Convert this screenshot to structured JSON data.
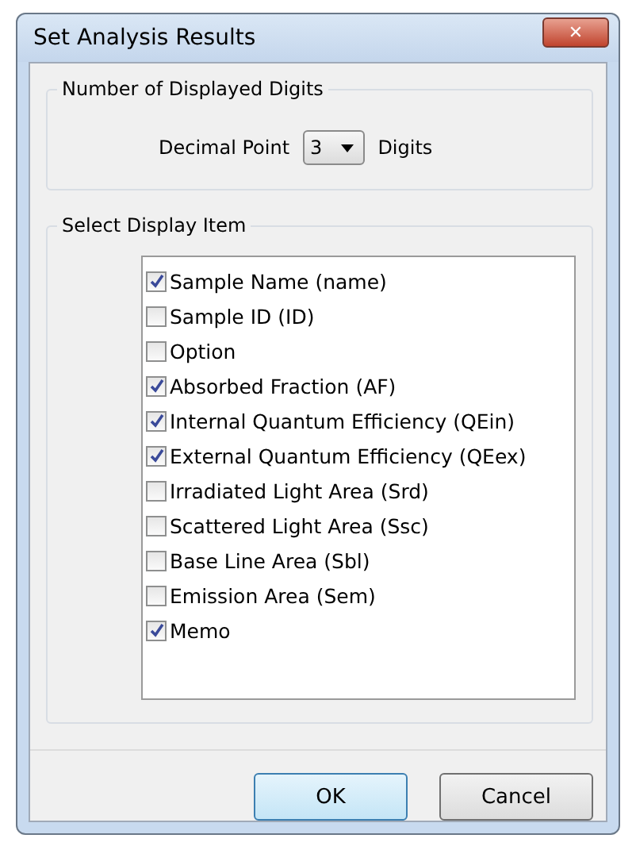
{
  "window": {
    "title": "Set Analysis Results",
    "close": "✕"
  },
  "digits_group": {
    "title": "Number of Displayed Digits",
    "label": "Decimal Point",
    "value": "3",
    "unit": "Digits"
  },
  "items_group": {
    "title": "Select Display Item",
    "items": [
      {
        "label": "Sample Name (name)",
        "checked": true
      },
      {
        "label": "Sample ID (ID)",
        "checked": false
      },
      {
        "label": "Option",
        "checked": false
      },
      {
        "label": "Absorbed Fraction (AF)",
        "checked": true
      },
      {
        "label": "Internal Quantum Efficiency (QEin)",
        "checked": true
      },
      {
        "label": "External Quantum Efficiency (QEex)",
        "checked": true
      },
      {
        "label": "Irradiated Light Area (Srd)",
        "checked": false
      },
      {
        "label": "Scattered Light Area (Ssc)",
        "checked": false
      },
      {
        "label": "Base Line Area (Sbl)",
        "checked": false
      },
      {
        "label": "Emission Area (Sem)",
        "checked": false
      },
      {
        "label": "Memo",
        "checked": true
      }
    ]
  },
  "buttons": [
    {
      "label": "OK",
      "default": true
    },
    {
      "label": "Cancel",
      "default": false
    }
  ]
}
